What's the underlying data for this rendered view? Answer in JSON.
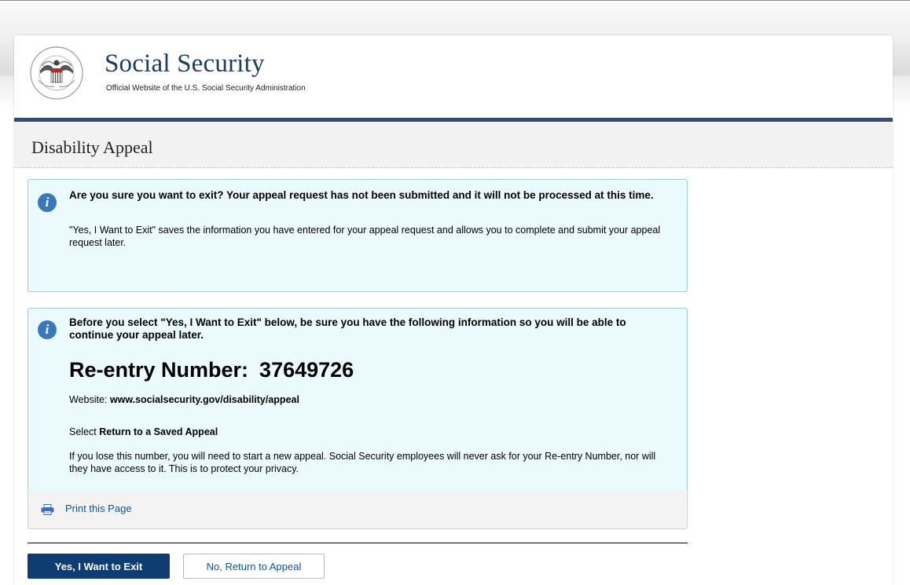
{
  "header": {
    "title": "Social Security",
    "subtitle": "Official Website of the U.S. Social Security Administration",
    "seal_icon": "ssa-seal-icon",
    "seal_text": "SOCIAL SECURITY ADMINISTRATION USA"
  },
  "page": {
    "title": "Disability Appeal"
  },
  "exit_alert": {
    "icon": "info-icon",
    "heading": "Are you sure you want to exit?  Your appeal request has not been submitted and it will not be processed at this time.",
    "body": "\"Yes, I Want to Exit\" saves the information you have entered for your appeal request and allows you to complete and submit your appeal request later."
  },
  "reentry_alert": {
    "icon": "info-icon",
    "heading": "Before you select \"Yes, I Want to Exit\" below, be sure you have the following information so you will be able to continue your appeal later.",
    "reentry_label": "Re-entry Number:",
    "reentry_number": "37649726",
    "website_label": "Website:",
    "website_value": "www.socialsecurity.gov/disability/appeal",
    "select_label": "Select",
    "select_value": "Return to a Saved Appeal",
    "warning": "If you lose this number, you will need to start a new appeal. Social Security employees will never ask for your Re-entry Number, nor will they have access to it. This is to protect your privacy."
  },
  "print": {
    "icon": "printer-icon",
    "label": "Print this Page"
  },
  "actions": {
    "exit_label": "Yes, I Want to Exit",
    "return_label": "No, Return to Appeal"
  },
  "colors": {
    "brand_navy": "#1f3a63",
    "header_bar": "#37496e",
    "alert_bg": "#ebfafd",
    "alert_border": "#9fcbd9",
    "info_icon": "#3a78bd",
    "link": "#0b55a8",
    "primary_button": "#0d3d73"
  }
}
